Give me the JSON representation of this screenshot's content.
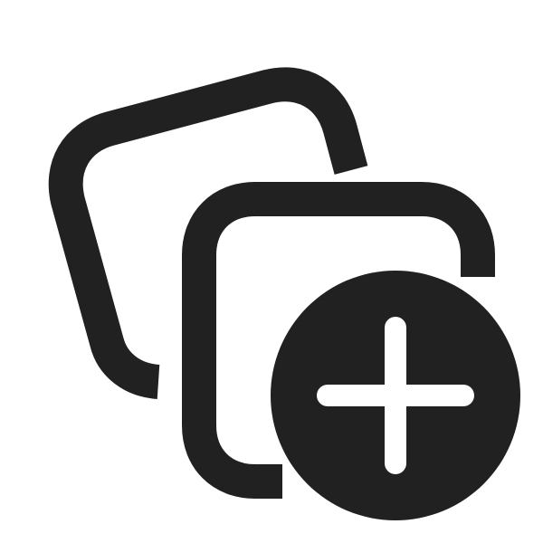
{
  "icon": {
    "name": "collection-add-icon",
    "parts": [
      "back-card-icon",
      "front-card-icon",
      "add-badge-icon",
      "plus-icon"
    ]
  },
  "colors": {
    "background": "#ffffff",
    "stroke": "#212121",
    "badge_fill": "#212121",
    "plus": "#ffffff"
  }
}
